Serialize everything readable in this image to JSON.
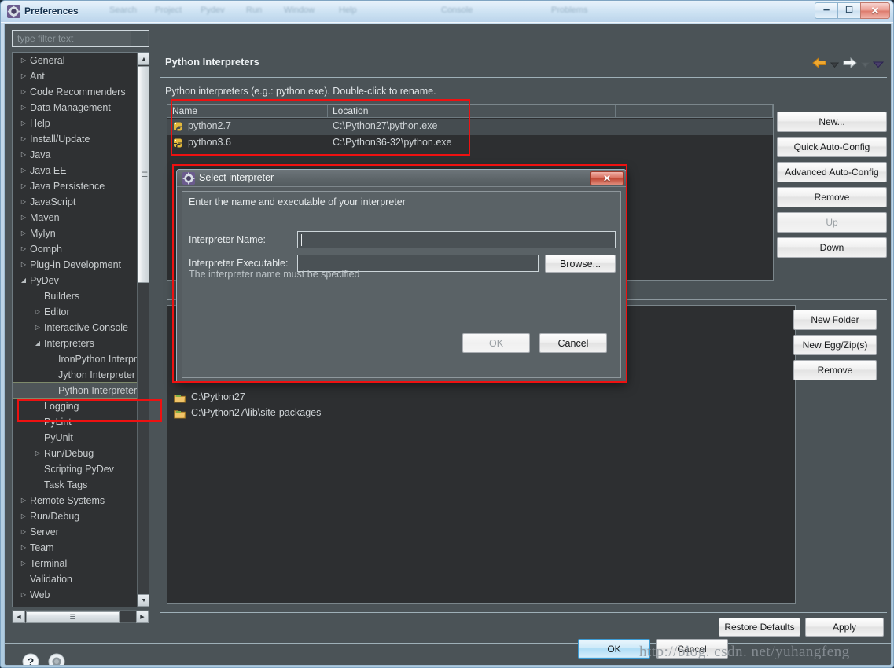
{
  "window": {
    "title": "Preferences",
    "icon": "preferences-gear-icon",
    "ghost_menu": [
      "Search",
      "Project",
      "Pydev",
      "Run",
      "Window",
      "Help"
    ],
    "buttons": {
      "minimize": "–",
      "maximize": "□",
      "close": "✕"
    }
  },
  "sidebar": {
    "filter": {
      "placeholder": "type filter text",
      "value": ""
    },
    "items": [
      {
        "label": "General",
        "indent": 0,
        "arrow": "collapsed"
      },
      {
        "label": "Ant",
        "indent": 0,
        "arrow": "collapsed"
      },
      {
        "label": "Code Recommenders",
        "indent": 0,
        "arrow": "collapsed"
      },
      {
        "label": "Data Management",
        "indent": 0,
        "arrow": "collapsed"
      },
      {
        "label": "Help",
        "indent": 0,
        "arrow": "collapsed"
      },
      {
        "label": "Install/Update",
        "indent": 0,
        "arrow": "collapsed"
      },
      {
        "label": "Java",
        "indent": 0,
        "arrow": "collapsed"
      },
      {
        "label": "Java EE",
        "indent": 0,
        "arrow": "collapsed"
      },
      {
        "label": "Java Persistence",
        "indent": 0,
        "arrow": "collapsed"
      },
      {
        "label": "JavaScript",
        "indent": 0,
        "arrow": "collapsed"
      },
      {
        "label": "Maven",
        "indent": 0,
        "arrow": "collapsed"
      },
      {
        "label": "Mylyn",
        "indent": 0,
        "arrow": "collapsed"
      },
      {
        "label": "Oomph",
        "indent": 0,
        "arrow": "collapsed"
      },
      {
        "label": "Plug-in Development",
        "indent": 0,
        "arrow": "collapsed"
      },
      {
        "label": "PyDev",
        "indent": 0,
        "arrow": "expanded"
      },
      {
        "label": "Builders",
        "indent": 1,
        "arrow": "none"
      },
      {
        "label": "Editor",
        "indent": 1,
        "arrow": "collapsed"
      },
      {
        "label": "Interactive Console",
        "indent": 1,
        "arrow": "collapsed"
      },
      {
        "label": "Interpreters",
        "indent": 1,
        "arrow": "expanded"
      },
      {
        "label": "IronPython Interpreter",
        "indent": 2,
        "arrow": "none"
      },
      {
        "label": "Jython Interpreter",
        "indent": 2,
        "arrow": "none"
      },
      {
        "label": "Python Interpreter",
        "indent": 2,
        "arrow": "none",
        "selected": true
      },
      {
        "label": "Logging",
        "indent": 1,
        "arrow": "none"
      },
      {
        "label": "PyLint",
        "indent": 1,
        "arrow": "none"
      },
      {
        "label": "PyUnit",
        "indent": 1,
        "arrow": "none"
      },
      {
        "label": "Run/Debug",
        "indent": 1,
        "arrow": "collapsed"
      },
      {
        "label": "Scripting PyDev",
        "indent": 1,
        "arrow": "none"
      },
      {
        "label": "Task Tags",
        "indent": 1,
        "arrow": "none"
      },
      {
        "label": "Remote Systems",
        "indent": 0,
        "arrow": "collapsed"
      },
      {
        "label": "Run/Debug",
        "indent": 0,
        "arrow": "collapsed"
      },
      {
        "label": "Server",
        "indent": 0,
        "arrow": "collapsed"
      },
      {
        "label": "Team",
        "indent": 0,
        "arrow": "collapsed"
      },
      {
        "label": "Terminal",
        "indent": 0,
        "arrow": "collapsed"
      },
      {
        "label": "Validation",
        "indent": 0,
        "arrow": "none"
      },
      {
        "label": "Web",
        "indent": 0,
        "arrow": "collapsed"
      }
    ]
  },
  "page": {
    "title": "Python Interpreters",
    "description": "Python interpreters (e.g.: python.exe).   Double-click to rename.",
    "nav": {
      "back_icon": "back-arrow-icon",
      "back_menu_icon": "chevron-down-icon",
      "forward_icon": "forward-arrow-icon",
      "forward_menu_icon": "chevron-down-icon",
      "overflow_icon": "chevron-down-icon"
    },
    "table": {
      "columns": [
        "Name",
        "Location"
      ],
      "rows": [
        {
          "name": "python2.7",
          "location": "C:\\Python27\\python.exe",
          "selected": true
        },
        {
          "name": "python3.6",
          "location": "C:\\Python36-32\\python.exe",
          "selected": false
        }
      ]
    },
    "side_buttons": [
      {
        "label": "New...",
        "disabled": false
      },
      {
        "label": "Quick Auto-Config",
        "disabled": false
      },
      {
        "label": "Advanced Auto-Config",
        "disabled": false
      },
      {
        "label": "Remove",
        "disabled": false
      },
      {
        "label": "Up",
        "disabled": true
      },
      {
        "label": "Down",
        "disabled": false
      }
    ],
    "path_buttons": [
      {
        "label": "New Folder",
        "disabled": false
      },
      {
        "label": "New Egg/Zip(s)",
        "disabled": false
      },
      {
        "label": "Remove",
        "disabled": false
      }
    ],
    "path_rows": [
      {
        "text": "C:\\Python27",
        "icon": "folder-icon"
      },
      {
        "text": "C:\\Python27\\lib\\site-packages",
        "icon": "folder-icon"
      }
    ],
    "bottom_buttons": [
      {
        "label": "Restore Defaults"
      },
      {
        "label": "Apply"
      }
    ]
  },
  "footer": {
    "help_icon": "question-mark-icon",
    "settings_icon": "gear-circle-icon",
    "ok_label": "OK",
    "cancel_label": "Cancel"
  },
  "modal": {
    "title": "Select interpreter",
    "icon": "preferences-gear-icon",
    "close_label": "✕",
    "message": "Enter the name and executable of your interpreter",
    "fields": [
      {
        "label": "Interpreter Name:",
        "value": "",
        "focused": true
      },
      {
        "label": "Interpreter Executable:",
        "value": "",
        "focused": false
      }
    ],
    "browse_label": "Browse...",
    "error": "The interpreter name must be specified",
    "ok_label": "OK",
    "ok_disabled": true,
    "cancel_label": "Cancel"
  },
  "watermark": "http://blog. csdn. net/yuhangfeng",
  "colors": {
    "panel_bg": "#4b5357",
    "content_bg": "#2d2f31",
    "text": "#dfe4e7",
    "accent_red": "#ee1111",
    "default_button": "#aedcf5",
    "back_arrow": "#f0a830"
  }
}
